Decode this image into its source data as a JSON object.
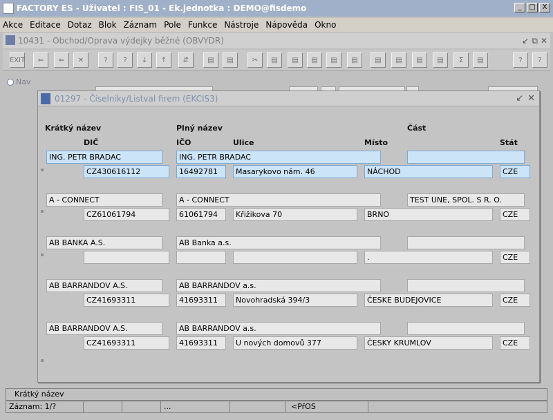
{
  "window": {
    "title": "FACTORY ES - Uživatel : FIS_01 - Ek.jednotka : DEMO@fisdemo",
    "buttons": [
      "_",
      "□",
      "X"
    ]
  },
  "menu": [
    "Akce",
    "Editace",
    "Dotaz",
    "Blok",
    "Záznam",
    "Pole",
    "Funkce",
    "Nástroje",
    "Nápověda",
    "Okno"
  ],
  "form": {
    "title": "10431 - Obchod/Oprava výdejky běžné (OBVYDR)",
    "nav_label": "Nav",
    "toolbar": [
      "EXIT",
      "⇐",
      "⇐",
      "✕",
      "?",
      "?",
      "↓",
      "↑",
      "⇵",
      "▤",
      "▤",
      "✂",
      "▤",
      "▤",
      "▤",
      "▤",
      "▤",
      "▤",
      "▤",
      "▤",
      "▤",
      "▤",
      "▤",
      "▤",
      "Σ",
      "▤",
      "?",
      "?"
    ]
  },
  "dialog": {
    "title": "01297 - Číselníky/Listval firem (EKCIS3)",
    "headers": {
      "short_name": "Krátký název",
      "full_name": "Plný název",
      "part": "Část",
      "dic": "DIČ",
      "ico": "IČO",
      "street": "Ulice",
      "city": "Místo",
      "state": "Stát"
    },
    "records": [
      {
        "short": "ING. PETR BRADAC",
        "full": "ING. PETR BRADAC",
        "part": "",
        "dic": "CZ430616112",
        "ico": "16492781",
        "street": "Masarykovo nám. 46",
        "city": "NÁCHOD",
        "state": "CZE"
      },
      {
        "short": "A - CONNECT",
        "full": "A - CONNECT",
        "part": "TEST UNE, SPOL. S R. O.",
        "dic": "CZ61061794",
        "ico": "61061794",
        "street": "Křižikova 70",
        "city": "BRNO",
        "state": "CZE"
      },
      {
        "short": "AB BANKA A.S.",
        "full": "AB Banka a.s.",
        "part": "",
        "dic": "",
        "ico": "",
        "street": "",
        "city": ".",
        "state": "CZE"
      },
      {
        "short": "AB BARRANDOV A.S.",
        "full": "AB BARRANDOV a.s.",
        "part": "",
        "dic": "CZ41693311",
        "ico": "41693311",
        "street": "Novohradská 394/3",
        "city": "ČESKE BUDEJOVICE",
        "state": "CZE"
      },
      {
        "short": "AB BARRANDOV A.S.",
        "full": "AB BARRANDOV a.s.",
        "part": "",
        "dic": "CZ41693311",
        "ico": "41693311",
        "street": "U nových domovů 377",
        "city": "ČESKY KRUMLOV",
        "state": "CZE"
      }
    ]
  },
  "status": {
    "hint": "Krátký název",
    "record": "Záznam: 1/?",
    "dots": "...",
    "mode": "<PřOS"
  }
}
